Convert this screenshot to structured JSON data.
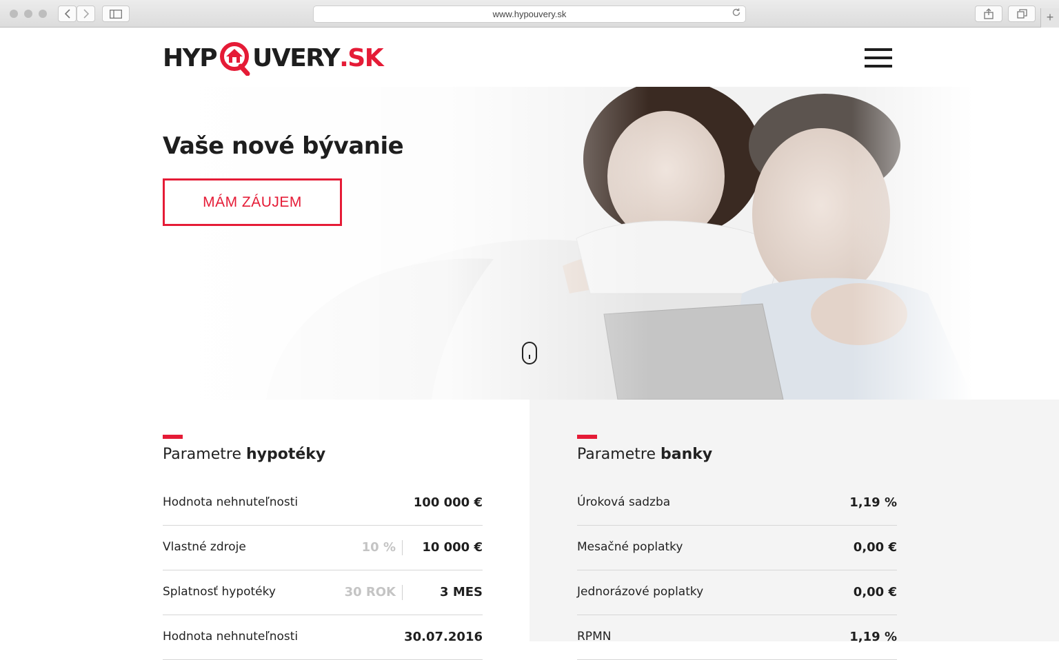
{
  "browser": {
    "url": "www.hypouvery.sk",
    "back_icon": "chevron-left-icon",
    "forward_icon": "chevron-right-icon",
    "sidebar_icon": "sidebar-icon",
    "share_icon": "share-icon",
    "tabs_icon": "tabs-icon",
    "newtab_label": "+"
  },
  "header": {
    "logo_left": "HYP",
    "logo_right": "UVERY",
    "logo_suffix": ".SK",
    "menu_icon": "hamburger-icon"
  },
  "hero": {
    "title": "Vaše nové bývanie",
    "cta_label": "MÁM ZÁUJEM",
    "scroll_icon": "mouse-scroll-icon"
  },
  "colors": {
    "accent": "#e51b36",
    "text": "#1e1e1e",
    "panel_bg": "#f4f4f4"
  },
  "mortgage": {
    "title_light": "Parametre ",
    "title_bold": "hypotéky",
    "rows": [
      {
        "label": "Hodnota nehnuteľnosti",
        "sub": "",
        "value": "100 000 €"
      },
      {
        "label": "Vlastné zdroje",
        "sub": "10 %",
        "value": "10 000 €"
      },
      {
        "label": "Splatnosť hypotéky",
        "sub": "30 ROK",
        "value": "3 MES"
      },
      {
        "label": "Hodnota nehnuteľnosti",
        "sub": "",
        "value": "30.07.2016"
      }
    ]
  },
  "bank": {
    "title_light": "Parametre ",
    "title_bold": "banky",
    "rows": [
      {
        "label": "Úroková sadzba",
        "value": "1,19 %"
      },
      {
        "label": "Mesačné poplatky",
        "value": "0,00 €"
      },
      {
        "label": "Jednorázové poplatky",
        "value": "0,00 €"
      },
      {
        "label": "RPMN",
        "value": "1,19 %"
      }
    ]
  }
}
